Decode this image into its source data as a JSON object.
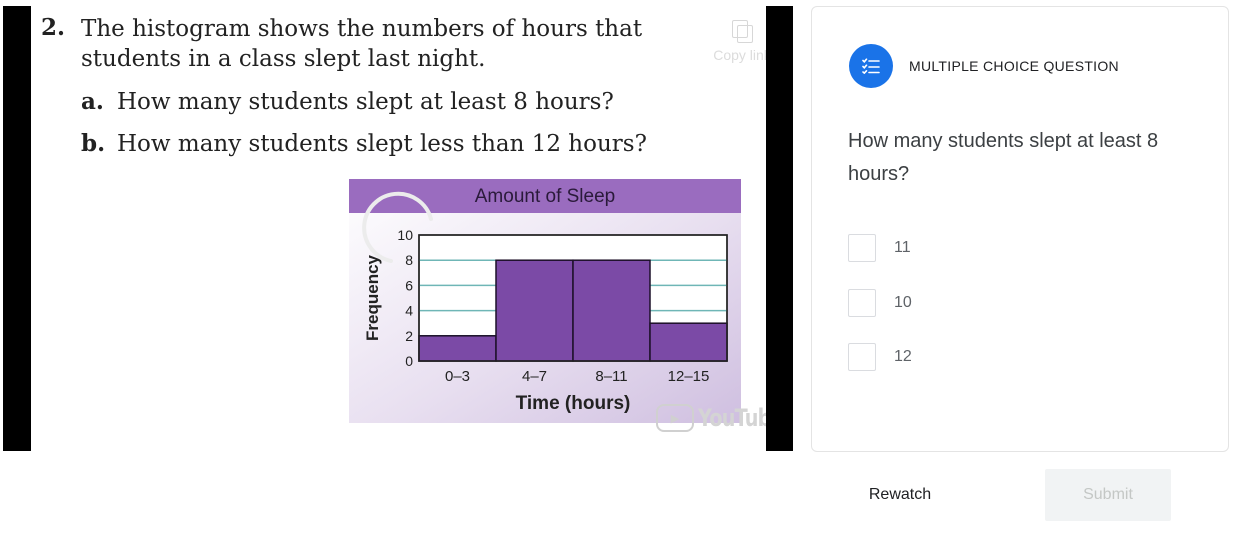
{
  "video": {
    "problem_number": "2.",
    "problem_text": "The histogram shows the numbers of hours that students in a class slept last night.",
    "part_a_letter": "a.",
    "part_a_text": "How many students slept at least 8 hours?",
    "part_b_letter": "b.",
    "part_b_text": "How many students slept less than 12 hours?",
    "copy_link_label": "Copy link",
    "youtube_label": "YouTube"
  },
  "chart_data": {
    "type": "bar",
    "title": "Amount of Sleep",
    "xlabel": "Time (hours)",
    "ylabel": "Frequency",
    "categories": [
      "0–3",
      "4–7",
      "8–11",
      "12–15"
    ],
    "values": [
      2,
      8,
      8,
      3
    ],
    "ylim": [
      0,
      10
    ],
    "yticks": [
      0,
      2,
      4,
      6,
      8,
      10
    ],
    "grid": true,
    "colors": {
      "bar": "#7b4aa6",
      "title_band": "#9a6cbf",
      "gridline": "#6fb6b6",
      "background": "#d9cfe4"
    }
  },
  "question": {
    "type_label": "MULTIPLE CHOICE QUESTION",
    "prompt": "How many students slept at least 8 hours?",
    "options": [
      {
        "label": "11"
      },
      {
        "label": "10"
      },
      {
        "label": "12"
      }
    ],
    "accent_color": "#1a73e8"
  },
  "actions": {
    "rewatch_label": "Rewatch",
    "submit_label": "Submit"
  }
}
